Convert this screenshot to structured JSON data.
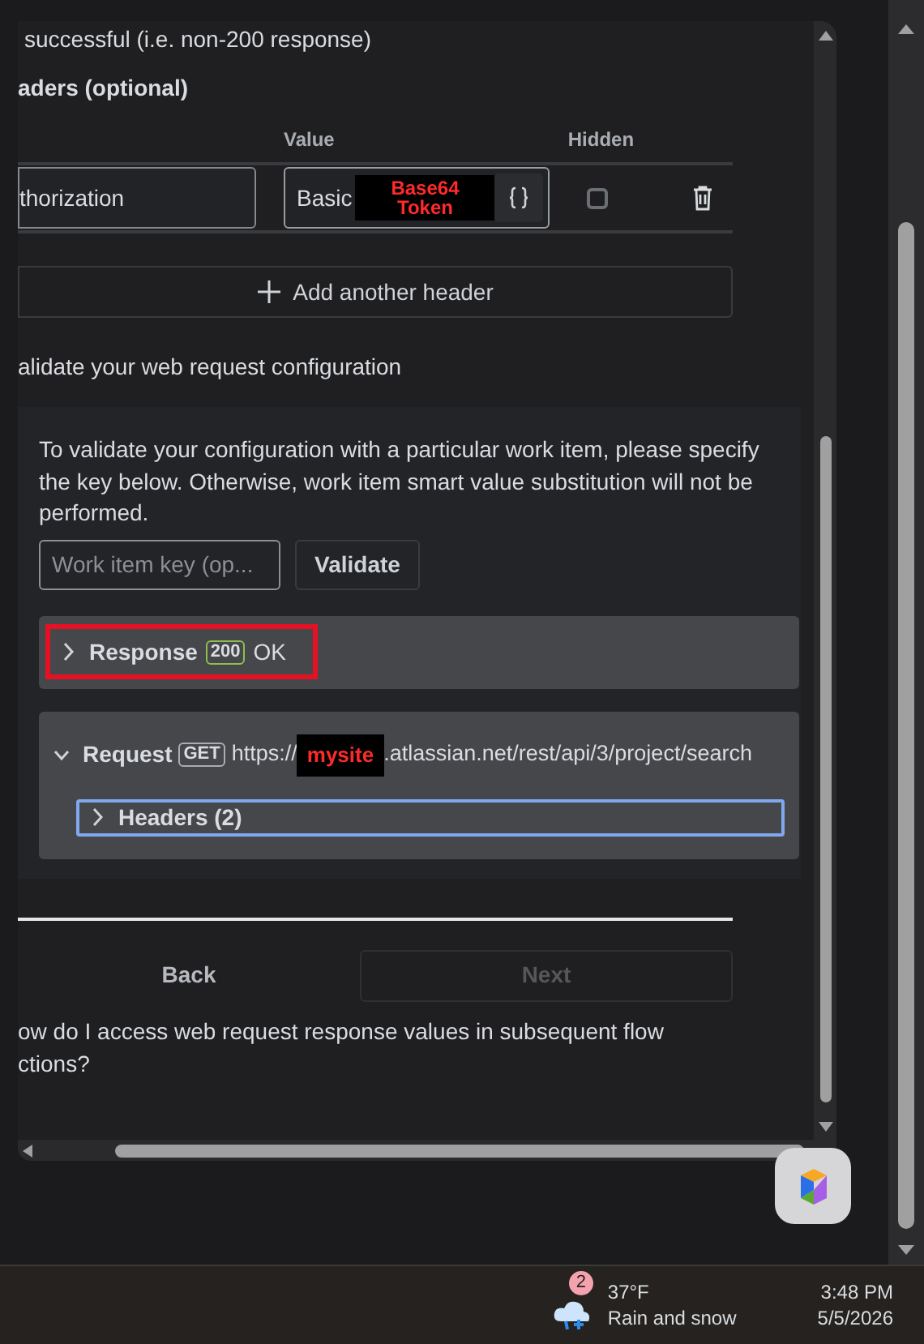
{
  "intro_text": "successful (i.e. non-200 response)",
  "headers_section": {
    "title": "aders (optional)",
    "columns": [
      "Value",
      "Hidden"
    ],
    "rows": [
      {
        "key": "thorization",
        "value": "Basic",
        "redaction": "Base64 Token",
        "hidden": false
      }
    ],
    "add_button": "Add another header"
  },
  "validate_section": {
    "title": "alidate your web request configuration",
    "description": "To validate your configuration with a particular work item, please specify the key below. Otherwise, work item smart value substitution will not be performed.",
    "key_field": {
      "placeholder": "Work item key (op..."
    },
    "validate_button": "Validate",
    "response": {
      "label": "Response",
      "status": "200",
      "status_text": "OK",
      "expanded": false,
      "highlighted": true
    },
    "request": {
      "label": "Request",
      "method": "GET",
      "url_start": "https://",
      "redaction": "mysite",
      "url_end": ".atlassian.net/rest/api/3/project/search",
      "expanded": true,
      "headers": {
        "label": "Headers (2)",
        "expanded": false
      }
    }
  },
  "nav": {
    "back": "Back",
    "next": "Next",
    "next_disabled": true
  },
  "help_lines": [
    "ow do I access web request response values in subsequent flow",
    "ctions?"
  ],
  "taskbar": {
    "weather_badge": "2",
    "temperature": "37°F",
    "weather": "Rain and snow",
    "time": "3:48 PM",
    "date": "5/5/2026"
  }
}
